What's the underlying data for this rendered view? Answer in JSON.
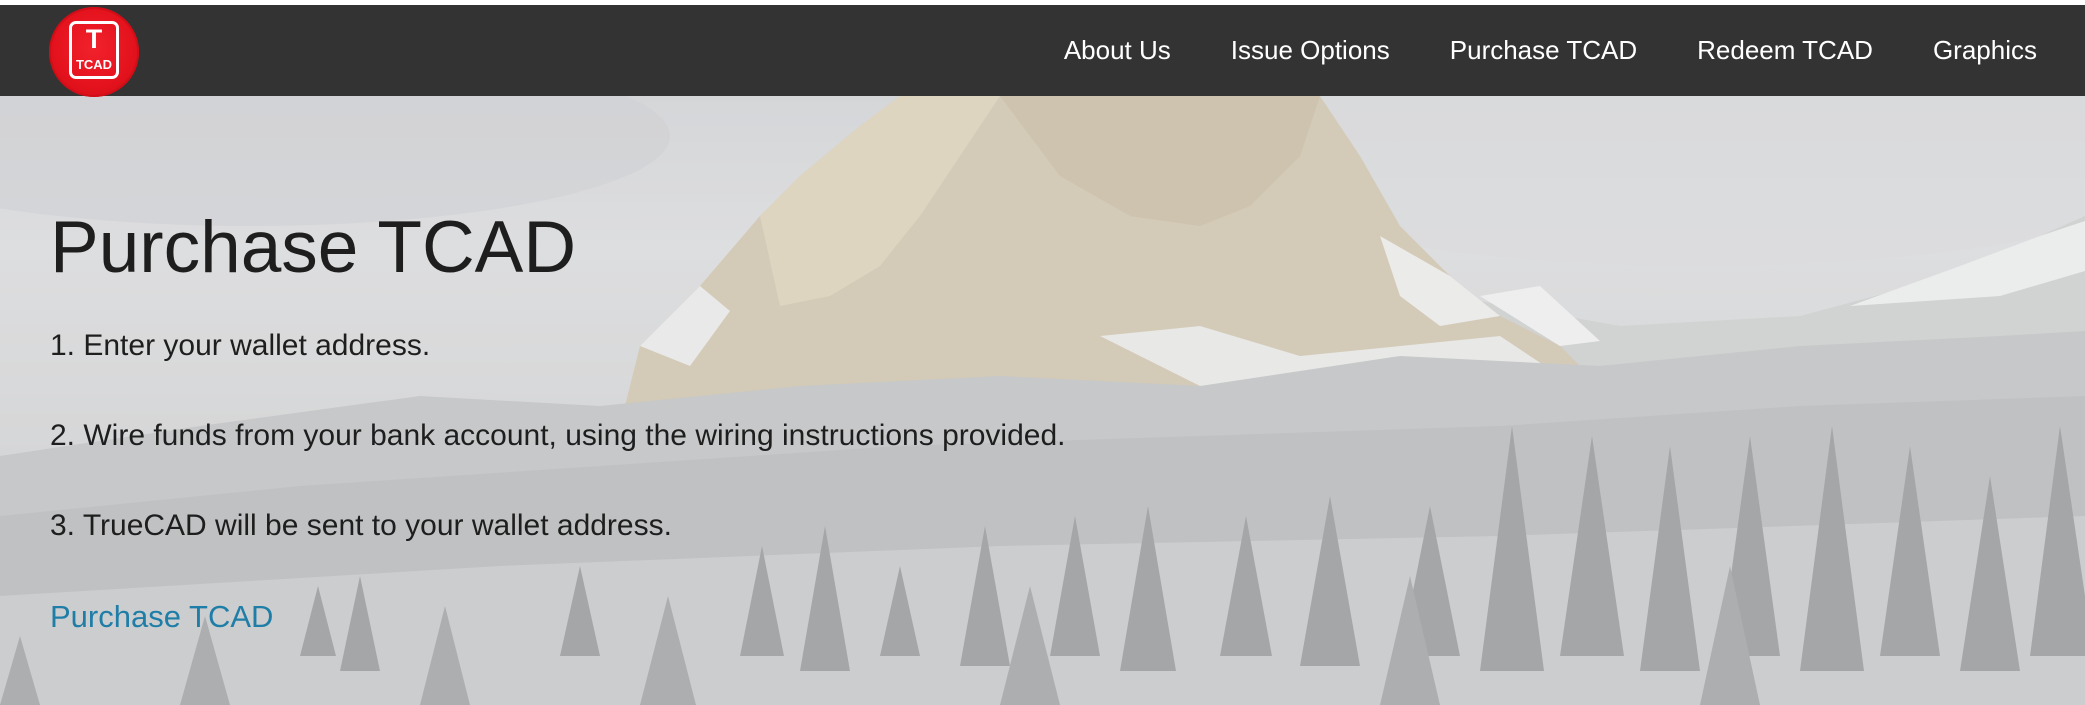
{
  "brand": {
    "logo_mark": "T",
    "logo_text": "TCAD"
  },
  "nav": {
    "items": [
      {
        "label": "About Us"
      },
      {
        "label": "Issue Options"
      },
      {
        "label": "Purchase TCAD"
      },
      {
        "label": "Redeem TCAD"
      },
      {
        "label": "Graphics"
      }
    ]
  },
  "hero": {
    "title": "Purchase TCAD",
    "steps": [
      "1. Enter your wallet address.",
      "2. Wire funds from your bank account, using the wiring instructions provided.",
      "3. TrueCAD will be sent to your wallet address."
    ],
    "cta_label": "Purchase TCAD"
  },
  "colors": {
    "navbar_bg": "#333333",
    "logo_red": "#e3121c",
    "link_blue": "#1f7ea8",
    "text_dark": "#1e1e1e"
  }
}
